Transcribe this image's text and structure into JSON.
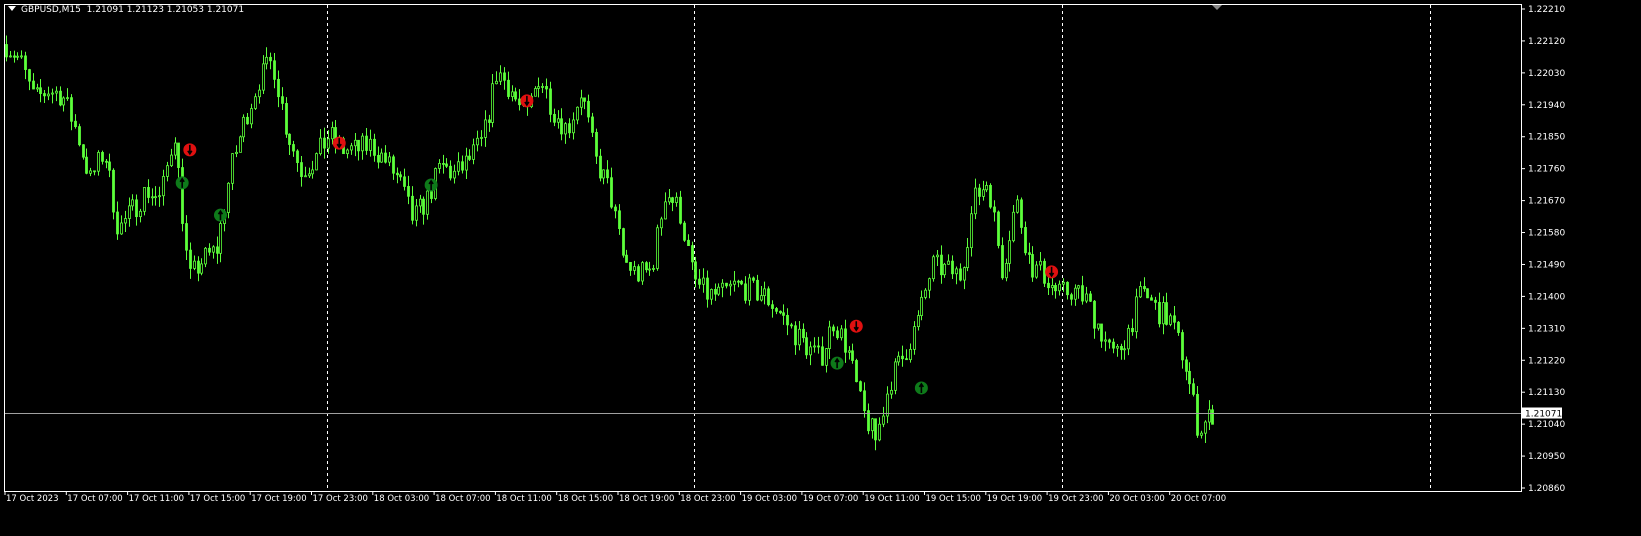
{
  "header": {
    "symbol": "GBPUSD,M15",
    "ohlc": "1.21091 1.21123 1.21053 1.21071"
  },
  "colors": {
    "background": "#000000",
    "candle": "#5CFF3A",
    "grid_axis": "#FFFFFF",
    "sell_signal": "#E01010",
    "buy_signal": "#0E7A1A",
    "price_line": "#A0A0A0"
  },
  "chart_data": {
    "type": "candlestick",
    "title": "GBPUSD,M15",
    "timeframe": "M15",
    "ylim": [
      1.2086,
      1.2221
    ],
    "y_ticks": [
      "1.22210",
      "1.22120",
      "1.22030",
      "1.21940",
      "1.21850",
      "1.21760",
      "1.21670",
      "1.21580",
      "1.21490",
      "1.21400",
      "1.21310",
      "1.21220",
      "1.21130",
      "1.21040",
      "1.20950",
      "1.20860"
    ],
    "x_ticks": [
      "17 Oct 2023",
      "17 Oct 07:00",
      "17 Oct 11:00",
      "17 Oct 15:00",
      "17 Oct 19:00",
      "17 Oct 23:00",
      "18 Oct 03:00",
      "18 Oct 07:00",
      "18 Oct 11:00",
      "18 Oct 15:00",
      "18 Oct 19:00",
      "18 Oct 23:00",
      "19 Oct 03:00",
      "19 Oct 07:00",
      "19 Oct 11:00",
      "19 Oct 15:00",
      "19 Oct 19:00",
      "19 Oct 23:00",
      "20 Oct 03:00",
      "20 Oct 07:00"
    ],
    "bars_count": 316,
    "close_path_approx": [
      1.2211,
      1.22066,
      1.21953,
      1.21982,
      1.21968,
      1.21869,
      1.21728,
      1.21813,
      1.21587,
      1.21643,
      1.217,
      1.21672,
      1.21869,
      1.21446,
      1.21503,
      1.21531,
      1.21756,
      1.21897,
      1.2201,
      1.22066,
      1.21869,
      1.21756,
      1.21784,
      1.21855,
      1.21813,
      1.21813,
      1.21827,
      1.21784,
      1.21728,
      1.21615,
      1.21672,
      1.2177,
      1.21742,
      1.21784,
      1.21841,
      1.22038,
      1.21982,
      1.21897,
      1.22024,
      1.21925,
      1.21869,
      1.21982,
      1.21784,
      1.217,
      1.21503,
      1.2146,
      1.21474,
      1.217,
      1.21643,
      1.21446,
      1.21404,
      1.21404,
      1.21432,
      1.21418,
      1.21404,
      1.21362,
      1.21305,
      1.21263,
      1.21221,
      1.21333,
      1.21249,
      1.2108,
      1.20995,
      1.21164,
      1.21235,
      1.21333,
      1.21488,
      1.21474,
      1.2146,
      1.21672,
      1.21728,
      1.21474,
      1.21672,
      1.21488,
      1.2146,
      1.21404,
      1.21418,
      1.2139,
      1.21305,
      1.21221,
      1.21305,
      1.21418,
      1.21362,
      1.21333,
      1.21221,
      1.21023,
      1.21071
    ],
    "current_price": "1.21071",
    "period_separators_bar": [
      84,
      180,
      276,
      372
    ],
    "signals": [
      {
        "type": "sell",
        "bar": 48,
        "price": 1.21813
      },
      {
        "type": "sell",
        "bar": 87,
        "price": 1.21832
      },
      {
        "type": "sell",
        "bar": 136,
        "price": 1.21951
      },
      {
        "type": "sell",
        "bar": 222,
        "price": 1.21316
      },
      {
        "type": "sell",
        "bar": 273,
        "price": 1.21469
      },
      {
        "type": "buy",
        "bar": 46,
        "price": 1.2172
      },
      {
        "type": "buy",
        "bar": 56,
        "price": 1.21629
      },
      {
        "type": "buy",
        "bar": 111,
        "price": 1.21714
      },
      {
        "type": "buy",
        "bar": 217,
        "price": 1.21212
      },
      {
        "type": "buy",
        "bar": 239,
        "price": 1.21142
      }
    ]
  }
}
